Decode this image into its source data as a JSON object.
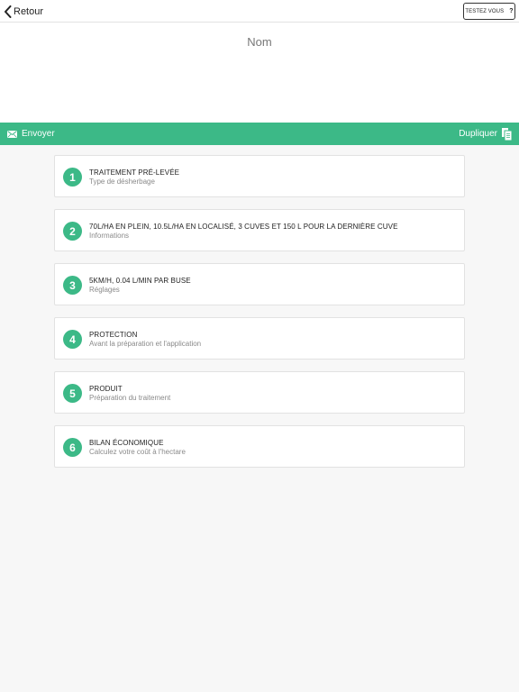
{
  "header": {
    "back_label": "Retour",
    "testez_label": "TESTEZ VOUS",
    "testez_icon": "?"
  },
  "name_field": {
    "placeholder": "Nom",
    "value": ""
  },
  "actionbar": {
    "send_label": "Envoyer",
    "send_icon": "envelope-icon",
    "duplicate_label": "Dupliquer",
    "duplicate_icon": "copy-document-icon",
    "color": "#3cb987"
  },
  "steps": [
    {
      "number": "1",
      "title": "TRAITEMENT PRÉ-LEVÉE",
      "subtitle": "Type de désherbage"
    },
    {
      "number": "2",
      "title": "70L/HA EN PLEIN, 10.5L/HA EN LOCALISÉ, 3 CUVES ET 150 L POUR LA DERNIÈRE CUVE",
      "subtitle": "Informations"
    },
    {
      "number": "3",
      "title": "5KM/H, 0.04 L/MIN PAR BUSE",
      "subtitle": "Réglages"
    },
    {
      "number": "4",
      "title": "PROTECTION",
      "subtitle": "Avant la préparation et l'application"
    },
    {
      "number": "5",
      "title": "PRODUIT",
      "subtitle": "Préparation du traitement"
    },
    {
      "number": "6",
      "title": "BILAN ÉCONOMIQUE",
      "subtitle": "Calculez votre coût à l'hectare"
    }
  ]
}
